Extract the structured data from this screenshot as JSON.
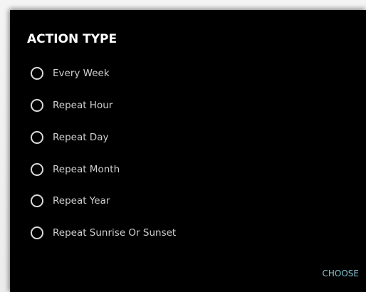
{
  "dialog": {
    "title": "ACTION TYPE",
    "options": [
      {
        "label": "Every Week",
        "selected": false
      },
      {
        "label": "Repeat Hour",
        "selected": false
      },
      {
        "label": "Repeat Day",
        "selected": false
      },
      {
        "label": "Repeat Month",
        "selected": false
      },
      {
        "label": "Repeat Year",
        "selected": false
      },
      {
        "label": "Repeat Sunrise Or Sunset",
        "selected": false
      }
    ],
    "choose_label": "CHOOSE"
  },
  "colors": {
    "dialog_bg": "#000000",
    "accent": "#7fc4cf",
    "text": "#cfcfcf"
  }
}
